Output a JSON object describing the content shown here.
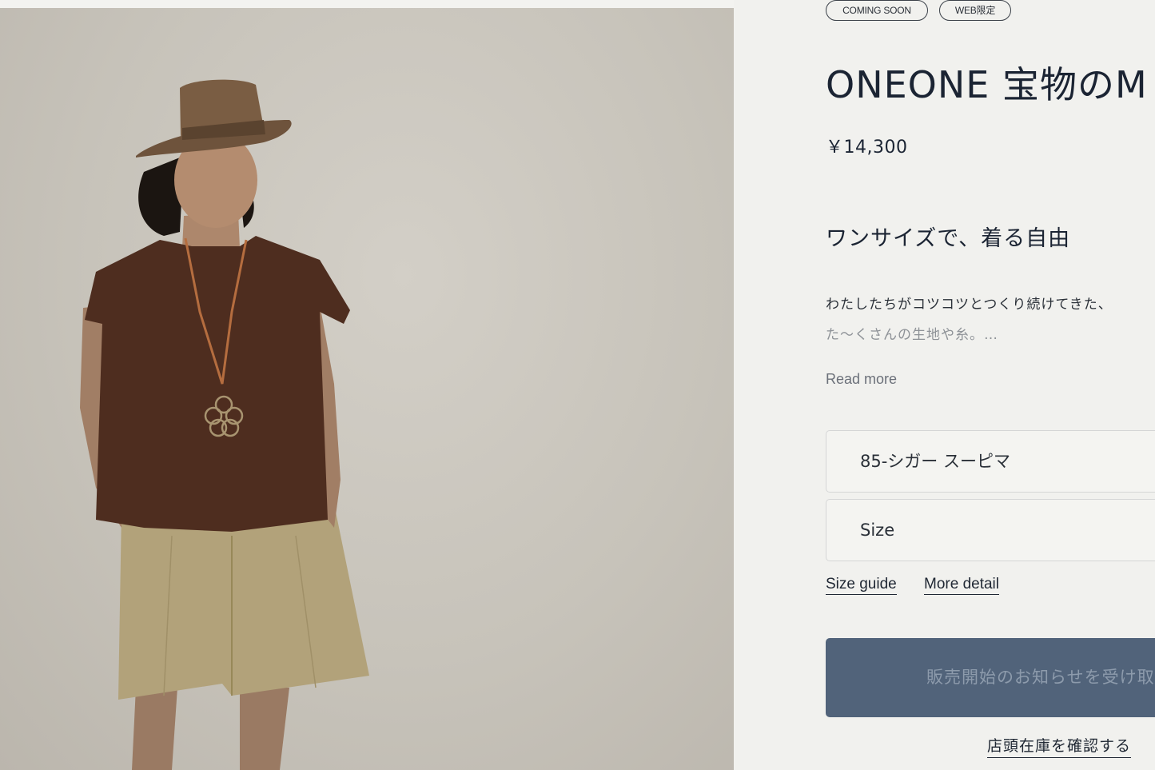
{
  "badges": {
    "coming_soon": "COMING SOON",
    "web_only": "WEB限定"
  },
  "product": {
    "title": "ONEONE 宝物のM",
    "price": "￥14,300",
    "subheading": "ワンサイズで、着る自由",
    "description_line1": "わたしたちがコツコツとつくり続けてきた、",
    "description_line2": "た～くさんの生地や糸。…",
    "read_more": "Read more"
  },
  "options": {
    "color_selected": "85-シガー スーピマ",
    "size_selected": "Size"
  },
  "links": {
    "size_guide": "Size guide",
    "more_detail": "More detail",
    "store_stock": "店頭在庫を確認する"
  },
  "buttons": {
    "notify": "販売開始のお知らせを受け取"
  },
  "colors": {
    "accent": "#51637a",
    "text": "#1b2433",
    "background": "#f1f1ee"
  }
}
